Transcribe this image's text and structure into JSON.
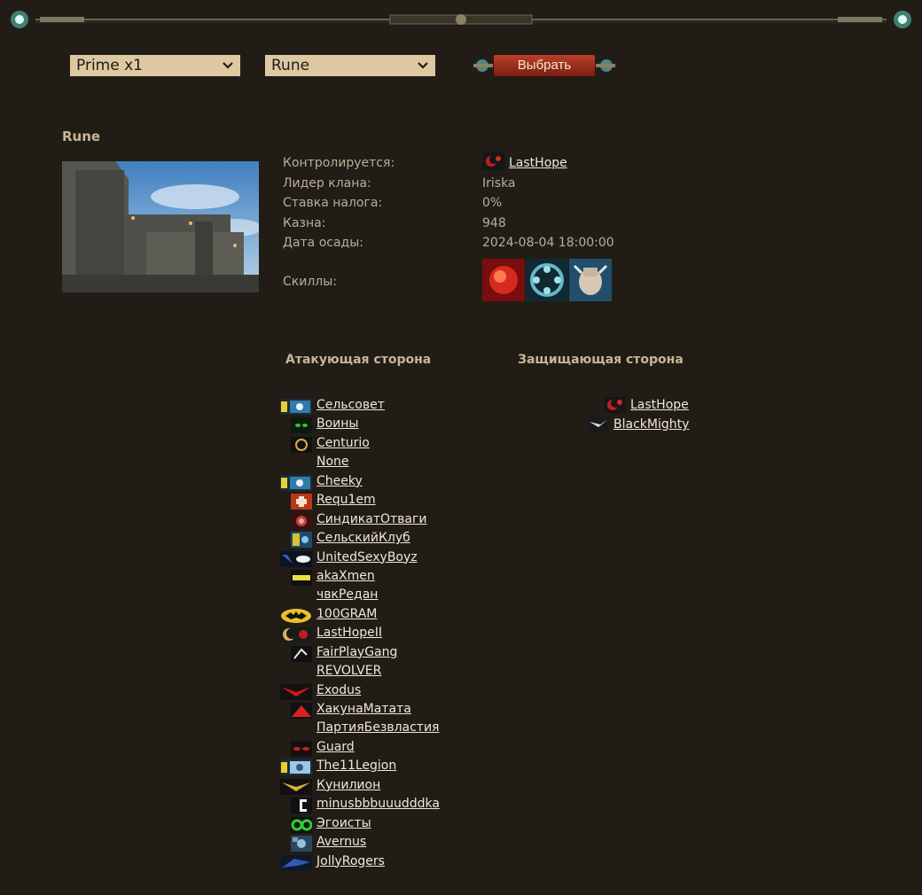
{
  "selectors": {
    "server": "Prime x1",
    "castle": "Rune",
    "submit_label": "Выбрать"
  },
  "castle": {
    "name": "Rune",
    "info": [
      {
        "label": "Контролируется:",
        "value": "LastHope",
        "is_link": true
      },
      {
        "label": "Лидер клана:",
        "value": "Iriska"
      },
      {
        "label": "Ставка налога:",
        "value": "0%"
      },
      {
        "label": "Казна:",
        "value": "948"
      },
      {
        "label": "Дата осады:",
        "value": "2024-08-04 18:00:00"
      }
    ],
    "skills_label": "Скиллы:",
    "skills": [
      "fire-skill-icon",
      "wheel-skill-icon",
      "fist-skill-icon"
    ]
  },
  "attackers": {
    "heading": "Атакующая сторона",
    "clans": [
      {
        "name": "Сельсовет",
        "emblem": "yellow-blue-crest"
      },
      {
        "name": "Воины",
        "emblem": "green-eyes"
      },
      {
        "name": "Centurio",
        "emblem": "gold-ring"
      },
      {
        "name": "None",
        "emblem": ""
      },
      {
        "name": "Cheeky",
        "emblem": "yellow-blue-crest"
      },
      {
        "name": "Requ1em",
        "emblem": "red-cross"
      },
      {
        "name": "СиндикатОтваги",
        "emblem": "red-ring"
      },
      {
        "name": "СельскийКлуб",
        "emblem": "blue-yellow-crest"
      },
      {
        "name": "UnitedSexyBoyz",
        "emblem": "blue-white-eye"
      },
      {
        "name": "akaXmen",
        "emblem": "men-text"
      },
      {
        "name": "чвкРедан",
        "emblem": ""
      },
      {
        "name": "100GRAM",
        "emblem": "batman-logo"
      },
      {
        "name": "LastHopeII",
        "emblem": "red-moon"
      },
      {
        "name": "FairPlayGang",
        "emblem": "white-scroll"
      },
      {
        "name": "REVOLVER",
        "emblem": ""
      },
      {
        "name": "Exodus",
        "emblem": "red-wings"
      },
      {
        "name": "ХакунаМатата",
        "emblem": "red-slash"
      },
      {
        "name": "ПартияБезвластия",
        "emblem": ""
      },
      {
        "name": "Guard",
        "emblem": "red-eyes"
      },
      {
        "name": "The11Legion",
        "emblem": "yellow-blue-crest"
      },
      {
        "name": "Кунилион",
        "emblem": "gold-wings"
      },
      {
        "name": "minusbbbuuudddka",
        "emblem": "white-letter"
      },
      {
        "name": "Эгоисты",
        "emblem": "go-green"
      },
      {
        "name": "Avernus",
        "emblem": "blue-crest"
      },
      {
        "name": "JollyRogers",
        "emblem": "blue-dragon"
      }
    ]
  },
  "defenders": {
    "heading": "Защищающая сторона",
    "clans": [
      {
        "name": "LastHope",
        "emblem": "red-moon"
      },
      {
        "name": "BlackMighty",
        "emblem": "white-bird"
      }
    ]
  }
}
